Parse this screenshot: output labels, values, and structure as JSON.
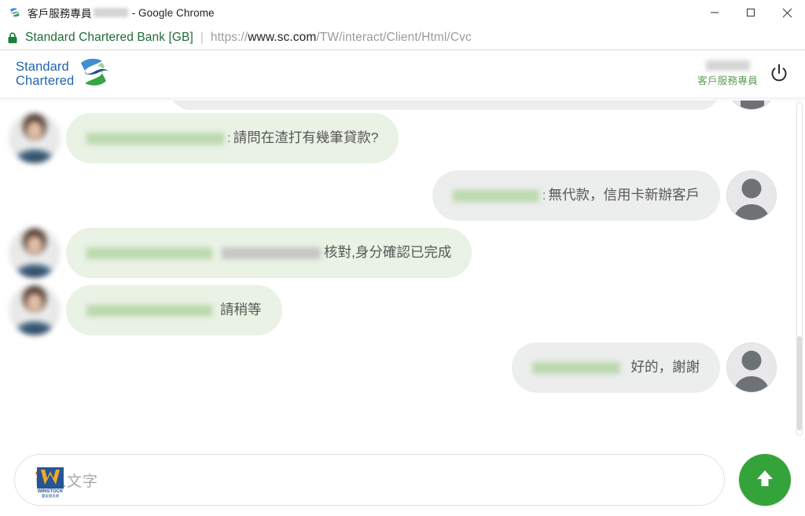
{
  "browser": {
    "tab_title_prefix": "客戶服務專員",
    "tab_title_suffix": "- Google Chrome",
    "favicon_name": "standard-chartered-favicon",
    "window_controls": {
      "minimize": "–",
      "maximize": "□",
      "close": "✕"
    },
    "security": {
      "lock_icon": "lock-icon",
      "site_name": "Standard Chartered Bank [GB]",
      "separator": "|"
    },
    "url": {
      "scheme": "https://",
      "host_strong": "www.sc.com",
      "path": "/TW/interact/Client/Html/Cvc",
      "full": "https://www.sc.com/TW/interact/Client/Html/Cvc"
    }
  },
  "app_header": {
    "logo_line1": "Standard",
    "logo_line2": "Chartered",
    "logo_icon_name": "standard-chartered-logo-mark",
    "agent_name_redacted": "",
    "agent_role": "客戶服務專員",
    "power_button_name": "power-off-button"
  },
  "chat": {
    "partial_top_message": {
      "sender": "user",
      "visible": true
    },
    "messages": [
      {
        "id": 1,
        "sender": "agent",
        "avatar": "agent-photo-avatar",
        "meta_redacted": true,
        "meta_width": 175,
        "colon": ":",
        "text": "請問在渣打有幾筆貸款?"
      },
      {
        "id": 2,
        "sender": "user",
        "avatar": "user-generic-avatar",
        "meta_redacted": true,
        "meta_width": 110,
        "colon": ":",
        "text": "無代款，信用卡新辦客戶"
      },
      {
        "id": 3,
        "sender": "agent",
        "avatar": "agent-photo-avatar",
        "meta_redacted": true,
        "meta_width": 160,
        "extra_redacted_width": 126,
        "colon": "",
        "text": "核對,身分確認已完成"
      },
      {
        "id": 4,
        "sender": "agent",
        "avatar": "agent-photo-avatar",
        "meta_redacted": true,
        "meta_width": 160,
        "colon": "",
        "text": "請稍等"
      },
      {
        "id": 5,
        "sender": "user",
        "avatar": "user-generic-avatar",
        "meta_redacted": true,
        "meta_width": 112,
        "colon": "",
        "text": "好的，謝謝"
      }
    ]
  },
  "composer": {
    "placeholder": "輸入文字",
    "value": "",
    "watermark_text": "WINSTOCK",
    "watermark_name": "winstock-watermark",
    "send_button_name": "send-message-button",
    "send_icon": "arrow-up-icon"
  },
  "colors": {
    "brand_blue": "#2065ae",
    "brand_green": "#34a43a",
    "agent_bubble": "#e9f2e4",
    "user_bubble": "#eceded",
    "site_name_green": "#1f6b3a",
    "agent_role_green": "#5e9e58"
  }
}
